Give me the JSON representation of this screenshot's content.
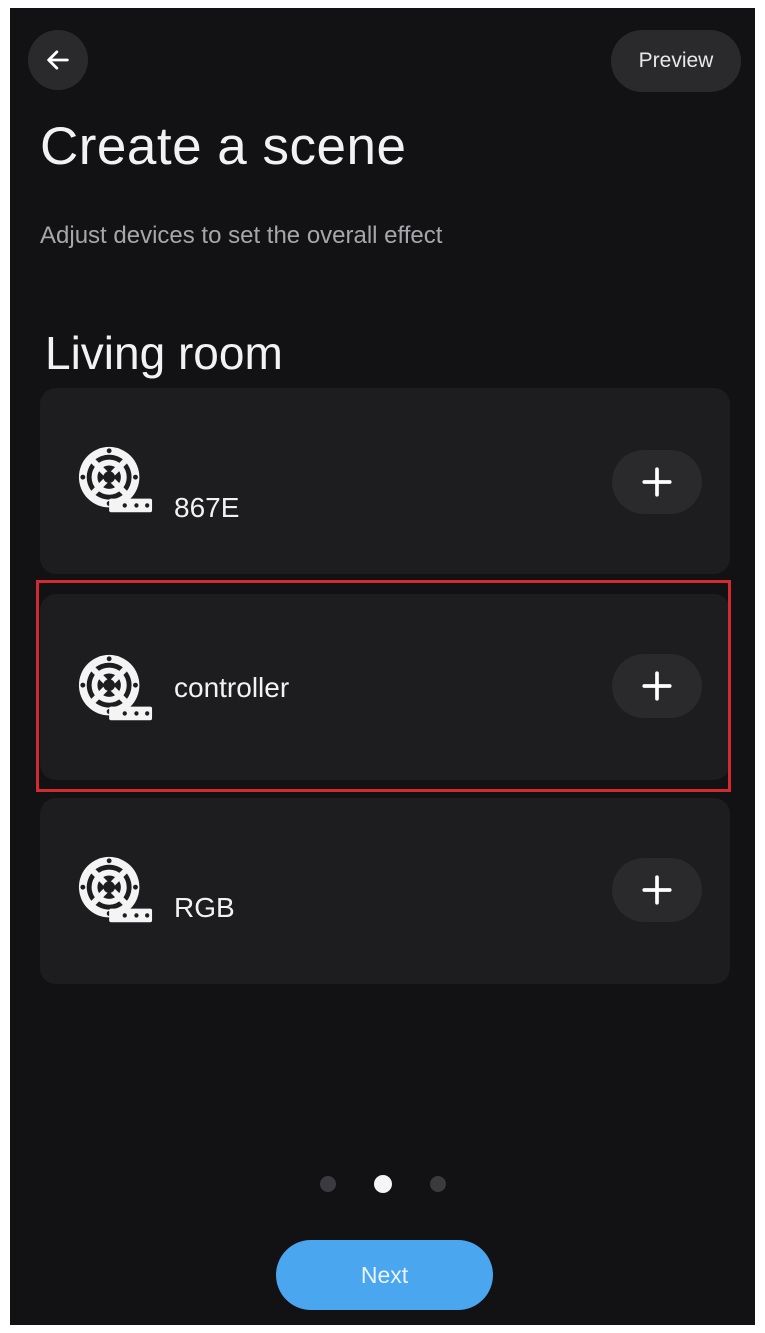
{
  "header": {
    "back_icon": "arrow-left-icon",
    "preview_label": "Preview"
  },
  "page": {
    "title": "Create a scene",
    "subtitle": "Adjust devices to set the overall effect"
  },
  "room": {
    "name": "Living room",
    "devices": [
      {
        "name": "867E",
        "icon": "led-strip-reel-icon",
        "selected": false
      },
      {
        "name": "controller",
        "icon": "led-strip-reel-icon",
        "selected": true
      },
      {
        "name": "RGB",
        "icon": "led-strip-reel-icon",
        "selected": false
      }
    ]
  },
  "pager": {
    "count": 3,
    "active_index": 1
  },
  "footer": {
    "next_label": "Next"
  },
  "colors": {
    "background": "#121214",
    "card": "#1d1d20",
    "accent": "#4aa6ee",
    "highlight": "#d32a2f"
  }
}
